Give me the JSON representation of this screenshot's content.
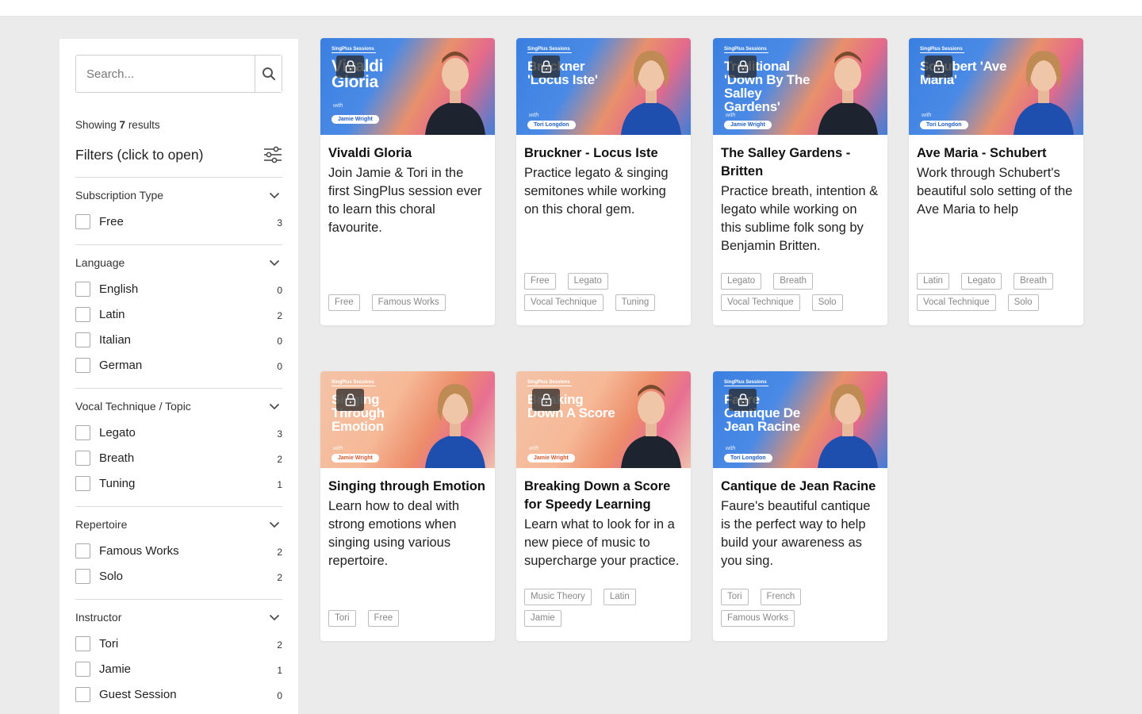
{
  "search": {
    "placeholder": "Search..."
  },
  "results": {
    "prefix": "Showing ",
    "count": "7",
    "suffix": " results"
  },
  "filters_title": "Filters (click to open)",
  "filter_groups": [
    {
      "title": "Subscription Type",
      "options": [
        {
          "label": "Free",
          "count": "3"
        }
      ]
    },
    {
      "title": "Language",
      "options": [
        {
          "label": "English",
          "count": "0"
        },
        {
          "label": "Latin",
          "count": "2"
        },
        {
          "label": "Italian",
          "count": "0"
        },
        {
          "label": "German",
          "count": "0"
        }
      ]
    },
    {
      "title": "Vocal Technique / Topic",
      "options": [
        {
          "label": "Legato",
          "count": "3"
        },
        {
          "label": "Breath",
          "count": "2"
        },
        {
          "label": "Tuning",
          "count": "1"
        }
      ]
    },
    {
      "title": "Repertoire",
      "options": [
        {
          "label": "Famous Works",
          "count": "2"
        },
        {
          "label": "Solo",
          "count": "2"
        }
      ]
    },
    {
      "title": "Instructor",
      "options": [
        {
          "label": "Tori",
          "count": "2"
        },
        {
          "label": "Jamie",
          "count": "1"
        },
        {
          "label": "Guest Session",
          "count": "0"
        }
      ]
    }
  ],
  "cards": [
    {
      "thumb": {
        "style": "blue",
        "brand": "SingPlus Sessions",
        "title": "Vivaldi Gloria",
        "with": "with",
        "instructor": "Jamie Wright",
        "person": "jamie"
      },
      "title": "Vivaldi Gloria",
      "desc": "Join Jamie & Tori in the first SingPlus session ever to learn this choral favourite.",
      "tags": [
        "Free",
        "Famous Works"
      ]
    },
    {
      "thumb": {
        "style": "blue",
        "brand": "SingPlus Sessions",
        "title": "Bruckner 'Locus Iste'",
        "with": "with",
        "instructor": "Tori Longdon",
        "person": "tori"
      },
      "title": "Bruckner - Locus Iste",
      "desc": "Practice legato & singing semitones while working on this choral gem.",
      "tags": [
        "Free",
        "Legato",
        "Vocal Technique",
        "Tuning"
      ]
    },
    {
      "thumb": {
        "style": "blue",
        "brand": "SingPlus Sessions",
        "title": "Traditional 'Down By The Salley Gardens'",
        "with": "with",
        "instructor": "Jamie Wright",
        "person": "jamie"
      },
      "title": "The Salley Gardens - Britten",
      "desc": "Practice breath, intention & legato while working on this sublime folk song by Benjamin Britten.",
      "tags": [
        "Legato",
        "Breath",
        "Vocal Technique",
        "Solo"
      ]
    },
    {
      "thumb": {
        "style": "blue",
        "brand": "SingPlus Sessions",
        "title": "Schubert 'Ave Maria'",
        "with": "with",
        "instructor": "Tori Longdon",
        "person": "tori"
      },
      "title": "Ave Maria - Schubert",
      "desc": "Work through Schubert's beautiful solo setting of the Ave Maria to help",
      "tags": [
        "Latin",
        "Legato",
        "Breath",
        "Vocal Technique",
        "Solo"
      ]
    },
    {
      "thumb": {
        "style": "peach",
        "brand": "SingPlus Sessions",
        "title": "Singing Through Emotion",
        "with": "with",
        "instructor": "Jamie Wright",
        "person": "tori"
      },
      "title": "Singing through Emotion",
      "desc": "Learn how to deal with strong emotions when singing using various repertoire.",
      "tags": [
        "Tori",
        "Free"
      ]
    },
    {
      "thumb": {
        "style": "peach",
        "brand": "SingPlus Sessions",
        "title": "Breaking Down A Score",
        "with": "with",
        "instructor": "Jamie Wright",
        "person": "jamie"
      },
      "title": "Breaking Down a Score for Speedy Learning",
      "desc": "Learn what to look for in a new piece of music to supercharge your practice.",
      "tags": [
        "Music Theory",
        "Latin",
        "Jamie"
      ]
    },
    {
      "thumb": {
        "style": "blue",
        "brand": "SingPlus Sessions",
        "title": "Faure Cantique De Jean Racine",
        "with": "with",
        "instructor": "Tori Longdon",
        "person": "tori"
      },
      "title": "Cantique de Jean Racine",
      "desc": "Faure's beautiful cantique is the perfect way to help build your awareness as you sing.",
      "tags": [
        "Tori",
        "French",
        "Famous Works"
      ]
    }
  ],
  "colors": {
    "brand_blue": "#3a7fe0",
    "jamie_shirt": "#1d2430",
    "tori_dress": "#1e4fae"
  },
  "icons": {
    "search": "search-icon",
    "filters": "sliders-icon",
    "chevron": "chevron-down-icon",
    "lock": "lock-icon"
  }
}
